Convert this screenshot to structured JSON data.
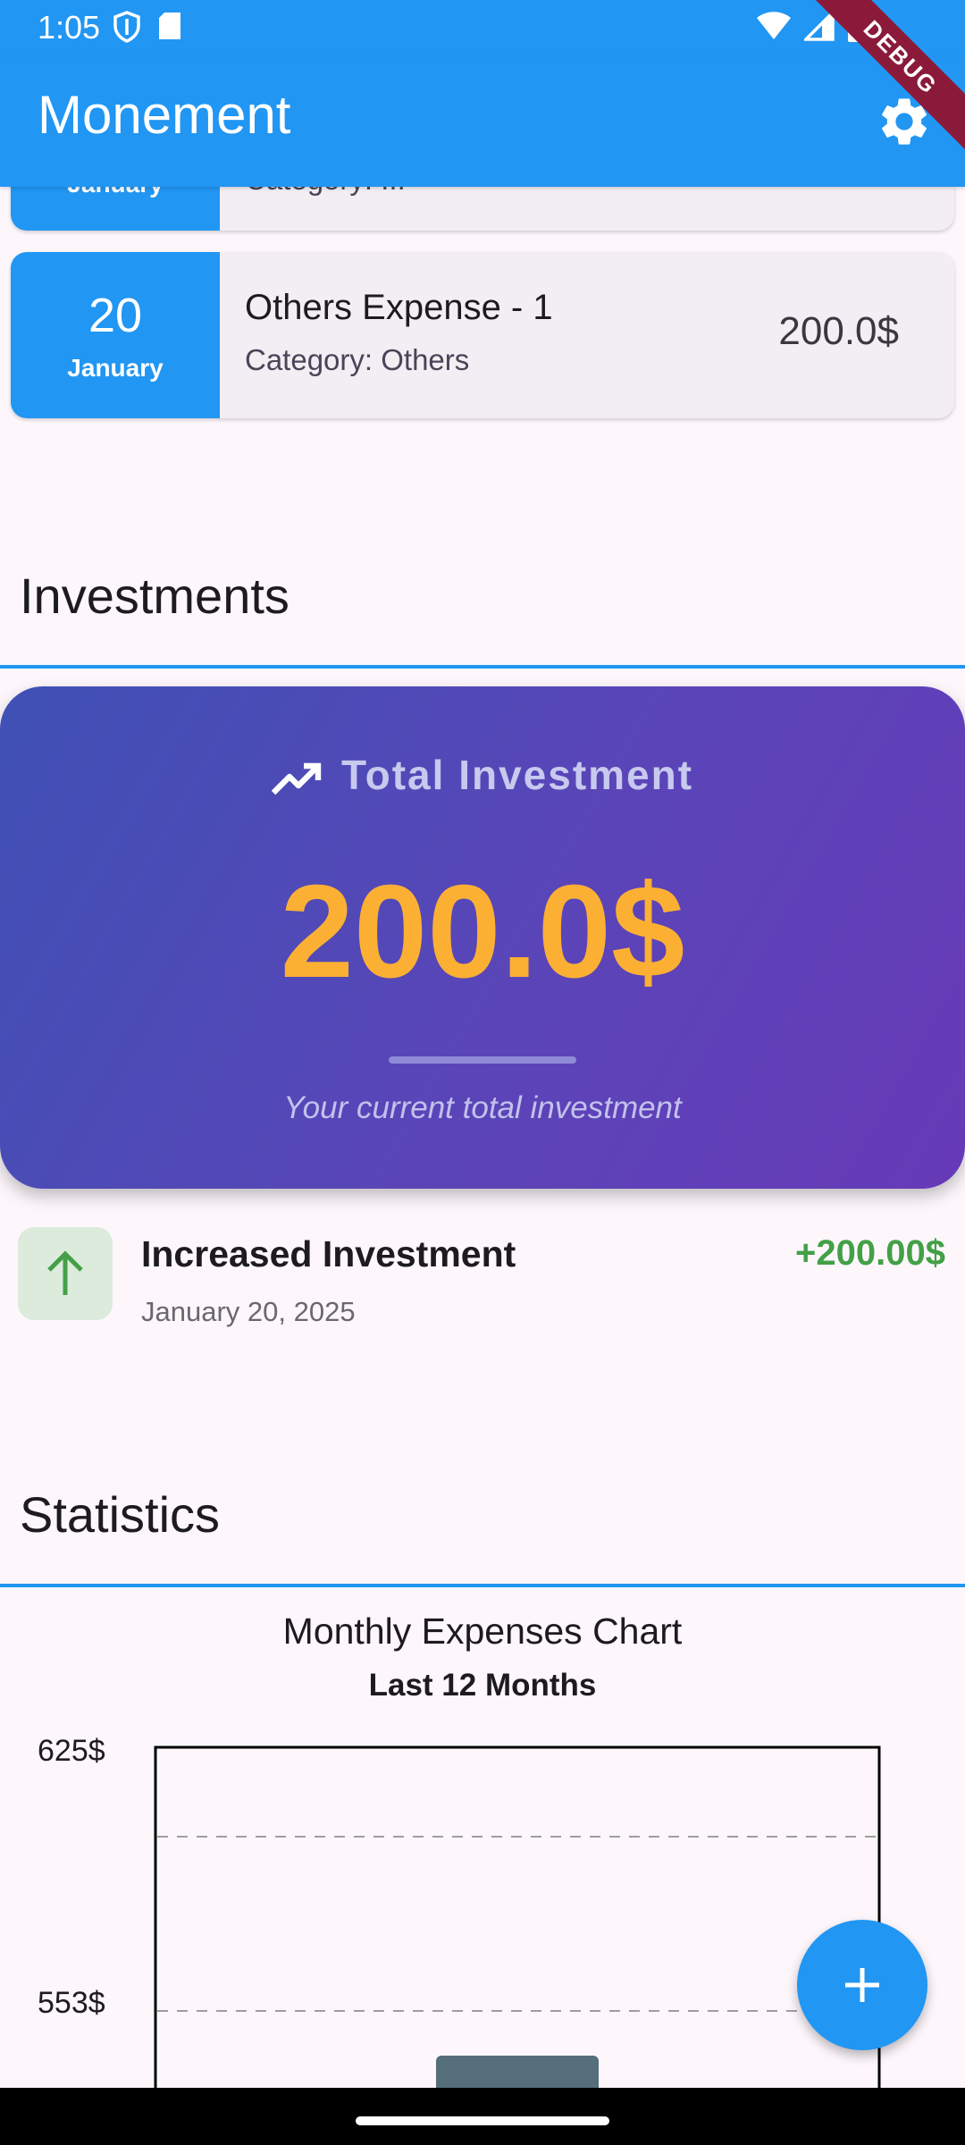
{
  "status_bar": {
    "time": "1:05",
    "left_icons": [
      "shield-icon",
      "sd-card-icon"
    ],
    "right_icons": [
      "wifi-icon",
      "signal-icon",
      "battery-icon"
    ],
    "debug_ribbon": "DEBUG"
  },
  "app_bar": {
    "title": "Monement",
    "settings_icon": "gear-icon",
    "color": "#2196F3"
  },
  "expenses": [
    {
      "day": "",
      "month": "January",
      "title": "",
      "category": "Category: ..."
    },
    {
      "day": "20",
      "month": "January",
      "title": "Others Expense - 1",
      "category": "Category: Others",
      "amount": "200.0$"
    }
  ],
  "investments": {
    "section_title": "Investments",
    "card": {
      "label": "Total Investment",
      "icon": "trending-up-icon",
      "amount": "200.0$",
      "note": "Your current total investment",
      "amount_color": "#FBB034"
    },
    "transactions": [
      {
        "icon": "arrow-up-icon",
        "title": "Increased Investment",
        "date": "January 20, 2025",
        "amount": "+200.00$",
        "color": "#43A047"
      }
    ]
  },
  "statistics": {
    "section_title": "Statistics"
  },
  "chart_data": {
    "type": "bar",
    "title": "Monthly Expenses Chart",
    "subtitle": "Last 12 Months",
    "y_tick_labels": [
      "625$",
      "553$"
    ],
    "grid": true,
    "values": [],
    "categories": []
  },
  "fab": {
    "icon": "plus-icon"
  }
}
